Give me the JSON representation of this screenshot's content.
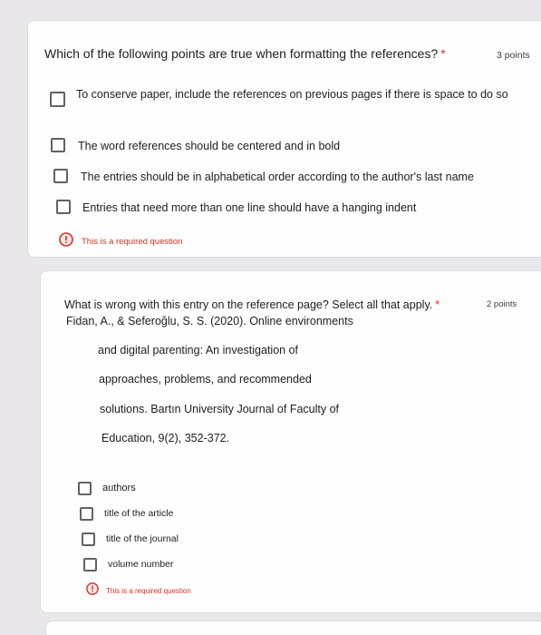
{
  "q1": {
    "title": "Which of the following points are true when formatting the references?",
    "required_mark": "*",
    "points": "3 points",
    "options": [
      {
        "label": "To conserve paper, include the references on previous pages if there is space to do so"
      },
      {
        "label": "The word references should be centered and in bold"
      },
      {
        "label": "The entries should be in alphabetical order according to the author's last name"
      },
      {
        "label": "Entries that need more than one line should have a hanging indent"
      }
    ],
    "error": "This is a required question"
  },
  "q2": {
    "title": "What is wrong with this entry on the reference page? Select all that apply.",
    "required_mark": "*",
    "points": "2 points",
    "entry_lines": [
      "Fidan, A., & Seferoğlu, S. S. (2020). Online environments",
      "and digital parenting: An investigation of",
      "approaches, problems, and recommended",
      "solutions. Bartın University Journal of Faculty of",
      "Education, 9(2), 352-372."
    ],
    "options": [
      {
        "label": "authors"
      },
      {
        "label": "title of the article"
      },
      {
        "label": "title of the journal"
      },
      {
        "label": "volume number"
      }
    ],
    "error": "This is a required question"
  },
  "colors": {
    "error": "#d93025",
    "checkbox_border": "#5f6368",
    "card_bg": "#fdfdfd",
    "page_bg": "#e9e7ea"
  }
}
